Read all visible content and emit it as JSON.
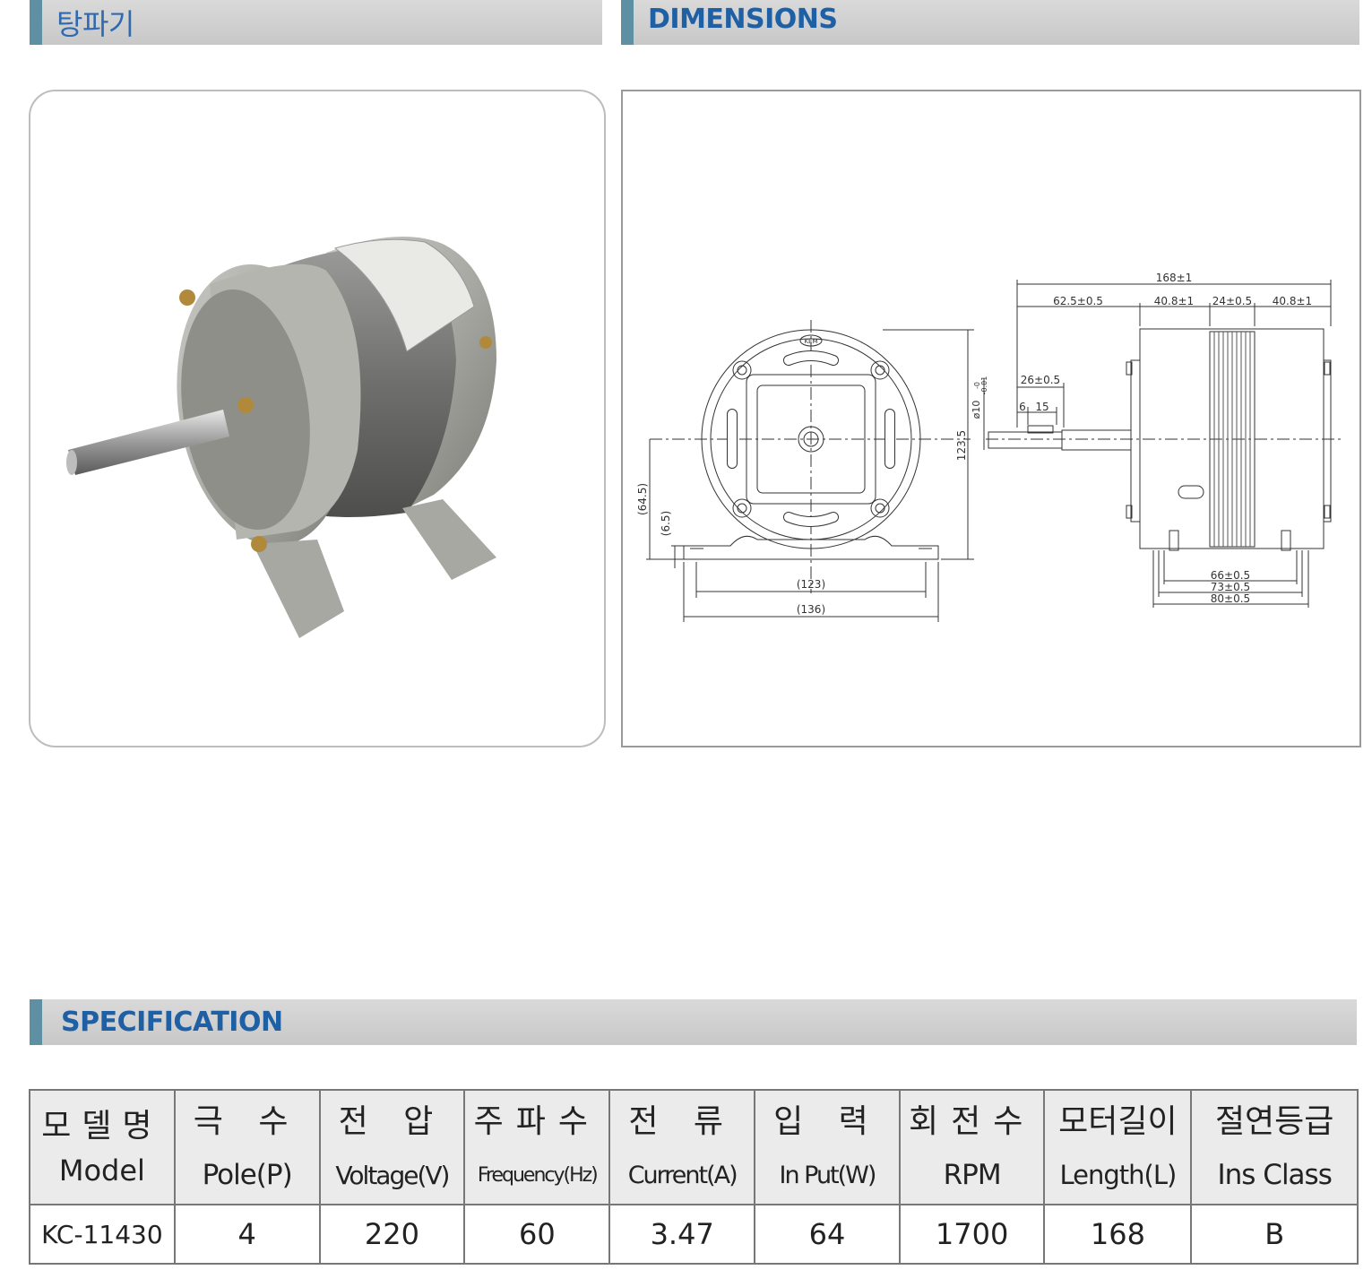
{
  "sections": {
    "product": "탕파기",
    "dimensions": "DIMENSIONS",
    "specification": "SPECIFICATION"
  },
  "drawing": {
    "front": {
      "dim_123": "(123)",
      "dim_136": "(136)",
      "dim_64_5": "(64.5)",
      "dim_6_5": "(6.5)",
      "dim_123_5": "123.5",
      "logo": "KEM"
    },
    "side": {
      "total": "168±1",
      "d1": "62.5±0.5",
      "d2": "40.8±1",
      "d3": "24±0.5",
      "d4": "40.8±1",
      "shaft": "26±0.5",
      "s6": "6",
      "s15": "15",
      "dia": "ø10",
      "dia_tol": "-0.01",
      "dia_tol_top": "-0",
      "b66": "66±0.5",
      "b73": "73±0.5",
      "b80": "80±0.5"
    }
  },
  "spec_table": {
    "headers_ko": [
      "모델명",
      "극 수",
      "전 압",
      "주파수",
      "전 류",
      "입 력",
      "회전수",
      "모터길이",
      "절연등급"
    ],
    "headers_en": [
      "Model",
      "Pole(P)",
      "Voltage(V)",
      "Frequency(Hz)",
      "Current(A)",
      "In Put(W)",
      "RPM",
      "Length(L)",
      "Ins Class"
    ],
    "row": [
      "KC-11430",
      "4",
      "220",
      "60",
      "3.47",
      "64",
      "1700",
      "168",
      "B"
    ]
  }
}
